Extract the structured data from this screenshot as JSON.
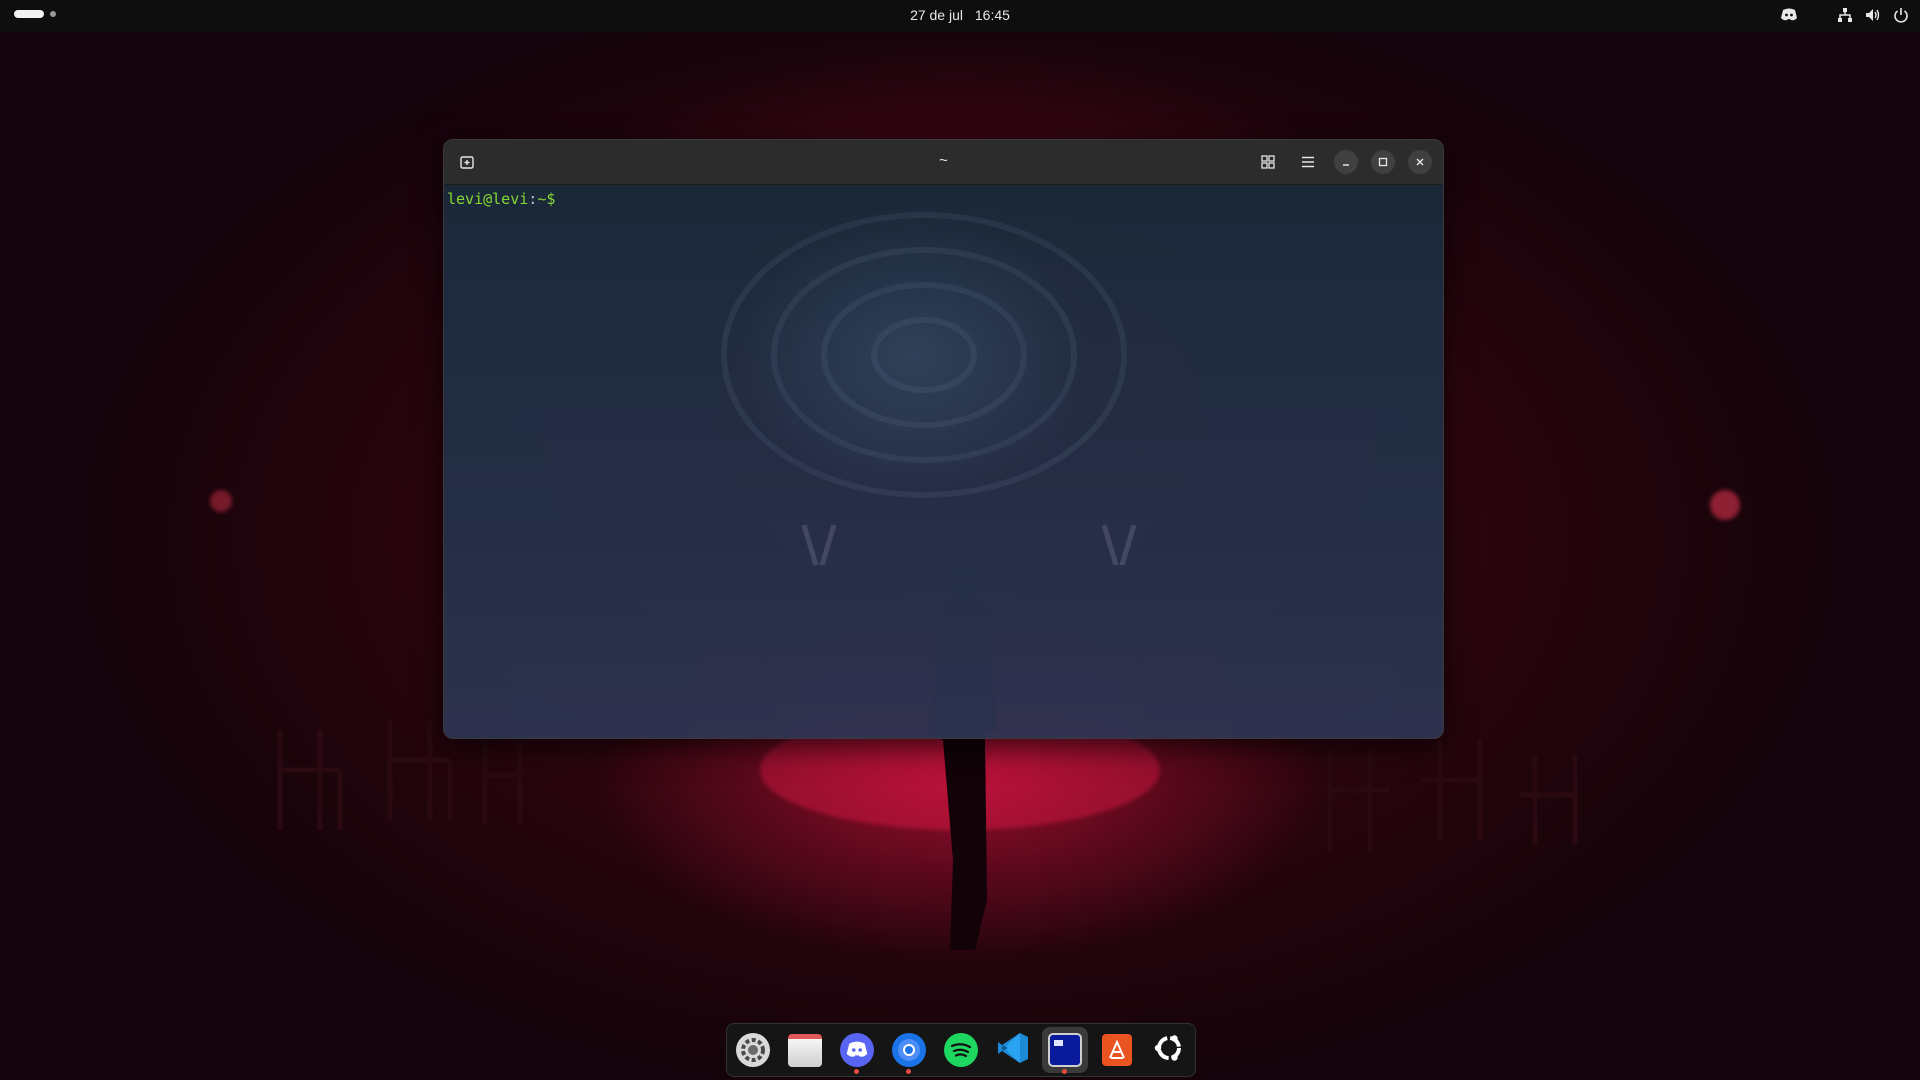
{
  "topbar": {
    "date": "27 de jul",
    "time": "16:45",
    "tray_icons": [
      "discord-icon",
      "network-icon",
      "volume-icon",
      "power-icon"
    ]
  },
  "terminal": {
    "title": "~",
    "prompt_user": "levi@levi",
    "prompt_sep": ":",
    "prompt_path": "~$",
    "header_icons": [
      "new-tab-icon",
      "tab-overview-icon",
      "menu-icon",
      "minimize-icon",
      "maximize-icon",
      "close-icon"
    ]
  },
  "dock": {
    "apps": [
      {
        "name": "settings",
        "running": false
      },
      {
        "name": "files",
        "running": false
      },
      {
        "name": "discord",
        "running": true
      },
      {
        "name": "chromium",
        "running": true
      },
      {
        "name": "spotify",
        "running": false
      },
      {
        "name": "vscode",
        "running": false
      },
      {
        "name": "terminal",
        "running": true,
        "active": true
      },
      {
        "name": "app-center",
        "running": false
      },
      {
        "name": "ubuntu-menu",
        "running": false
      }
    ]
  },
  "colors": {
    "prompt_green": "#8ae234",
    "wallpaper_red": "#b0102c"
  }
}
